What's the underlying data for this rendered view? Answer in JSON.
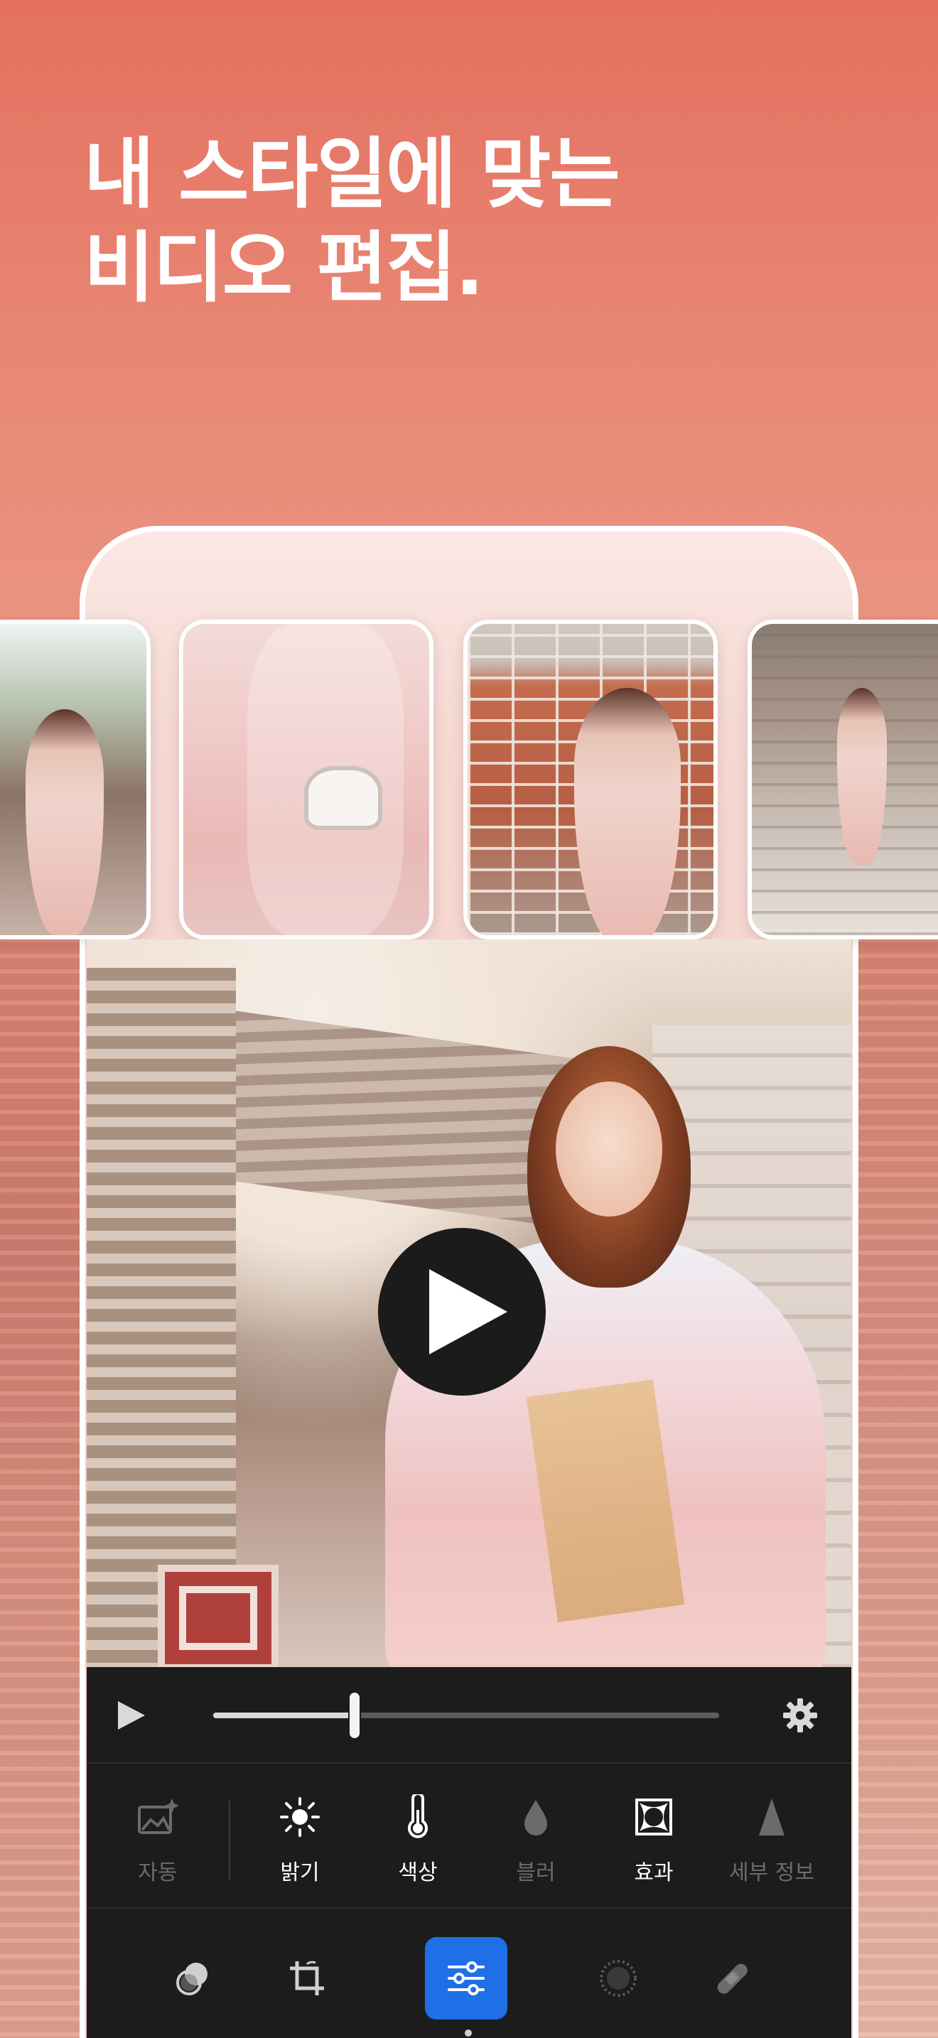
{
  "headline": {
    "line1": "내 스타일에 맞는",
    "line2": "비디오 편집."
  },
  "player": {
    "progress": 0.28
  },
  "tools": [
    {
      "label": "자동",
      "icon": "auto-enhance-icon",
      "enabled": false
    },
    {
      "label": "밝기",
      "icon": "brightness-sun-icon",
      "enabled": true
    },
    {
      "label": "색상",
      "icon": "thermometer-icon",
      "enabled": true
    },
    {
      "label": "블러",
      "icon": "drop-icon",
      "enabled": false
    },
    {
      "label": "효과",
      "icon": "vignette-frame-icon",
      "enabled": true
    },
    {
      "label": "세부 정보",
      "icon": "triangle-detail-icon",
      "enabled": false
    }
  ],
  "bottom_tabs": [
    {
      "icon": "filters-icon",
      "active": false
    },
    {
      "icon": "crop-rotate-icon",
      "active": false
    },
    {
      "icon": "adjust-sliders-icon",
      "active": true
    },
    {
      "icon": "vignette-dots-icon",
      "active": false
    },
    {
      "icon": "healing-bandage-icon",
      "active": false
    }
  ],
  "colors": {
    "accent": "#1f6fe6",
    "panel": "#1c1c1c",
    "background_top": "#e5705f"
  }
}
